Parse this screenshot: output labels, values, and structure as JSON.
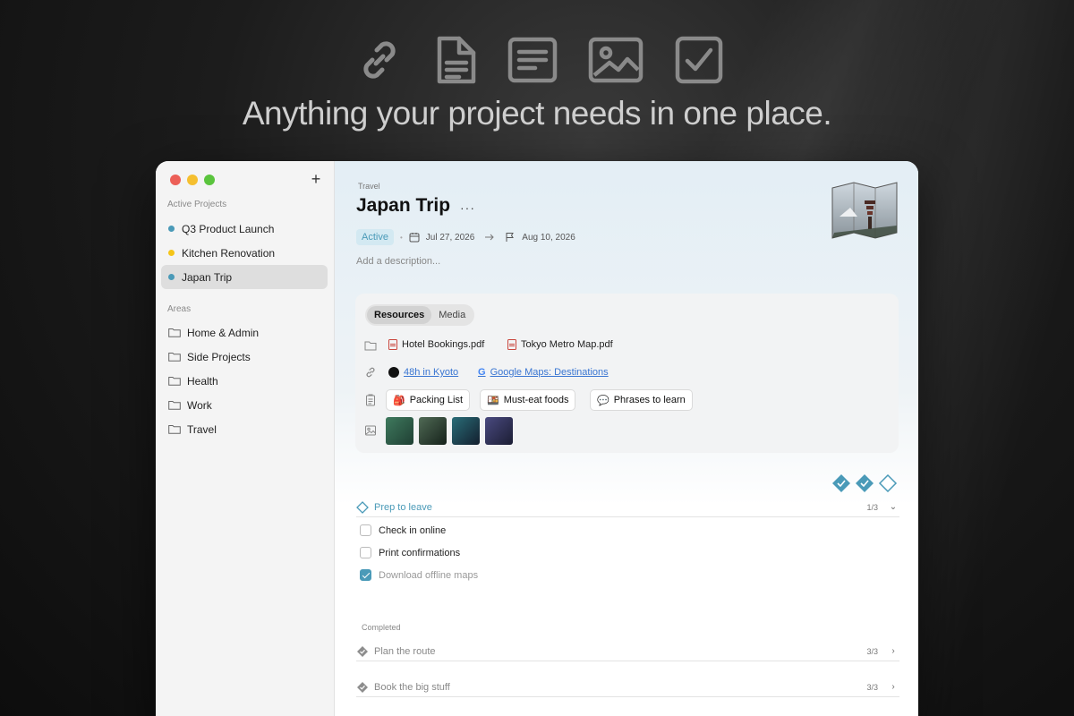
{
  "hero": {
    "icons": [
      "link-icon",
      "document-icon",
      "note-icon",
      "image-icon",
      "checkbox-icon"
    ],
    "title": "Anything your project needs in one place."
  },
  "sidebar": {
    "add_label": "+",
    "active_projects_label": "Active Projects",
    "projects": [
      {
        "label": "Q3 Product Launch",
        "color": "#4a9ab8"
      },
      {
        "label": "Kitchen Renovation",
        "color": "#f5c518"
      },
      {
        "label": "Japan Trip",
        "color": "#4a9ab8",
        "selected": true
      }
    ],
    "areas_label": "Areas",
    "areas": [
      {
        "label": "Home & Admin"
      },
      {
        "label": "Side Projects"
      },
      {
        "label": "Health"
      },
      {
        "label": "Work"
      },
      {
        "label": "Travel"
      }
    ]
  },
  "project": {
    "breadcrumb": "Travel",
    "title": "Japan Trip",
    "more": "···",
    "status": "Active",
    "separator": "•",
    "start_date": "Jul 27, 2026",
    "end_date": "Aug 10, 2026",
    "description_placeholder": "Add a description..."
  },
  "resources": {
    "tabs": [
      {
        "label": "Resources",
        "active": true
      },
      {
        "label": "Media",
        "active": false
      }
    ],
    "files": [
      {
        "label": "Hotel Bookings.pdf"
      },
      {
        "label": "Tokyo Metro Map.pdf"
      }
    ],
    "links": [
      {
        "label": "48h in Kyoto"
      },
      {
        "label": "Google Maps: Destinations"
      }
    ],
    "notes": [
      {
        "emoji": "🎒",
        "label": "Packing List"
      },
      {
        "emoji": "🍱",
        "label": "Must-eat foods"
      },
      {
        "emoji": "💬",
        "label": "Phrases to learn"
      }
    ],
    "photo_colors": [
      "#2f5a47",
      "#2c3a30",
      "#20404a",
      "#2b2f4a"
    ]
  },
  "tasks": {
    "active_group": {
      "title": "Prep to leave",
      "count": "1/3",
      "items": [
        {
          "label": "Check in online",
          "done": false
        },
        {
          "label": "Print confirmations",
          "done": false
        },
        {
          "label": "Download offline maps",
          "done": true
        }
      ]
    },
    "completed_label": "Completed",
    "completed_groups": [
      {
        "title": "Plan the route",
        "count": "3/3"
      },
      {
        "title": "Book the big stuff",
        "count": "3/3"
      }
    ]
  },
  "colors": {
    "accent": "#4a9ab8",
    "pdf": "#c9463d",
    "link": "#3a76d2"
  }
}
